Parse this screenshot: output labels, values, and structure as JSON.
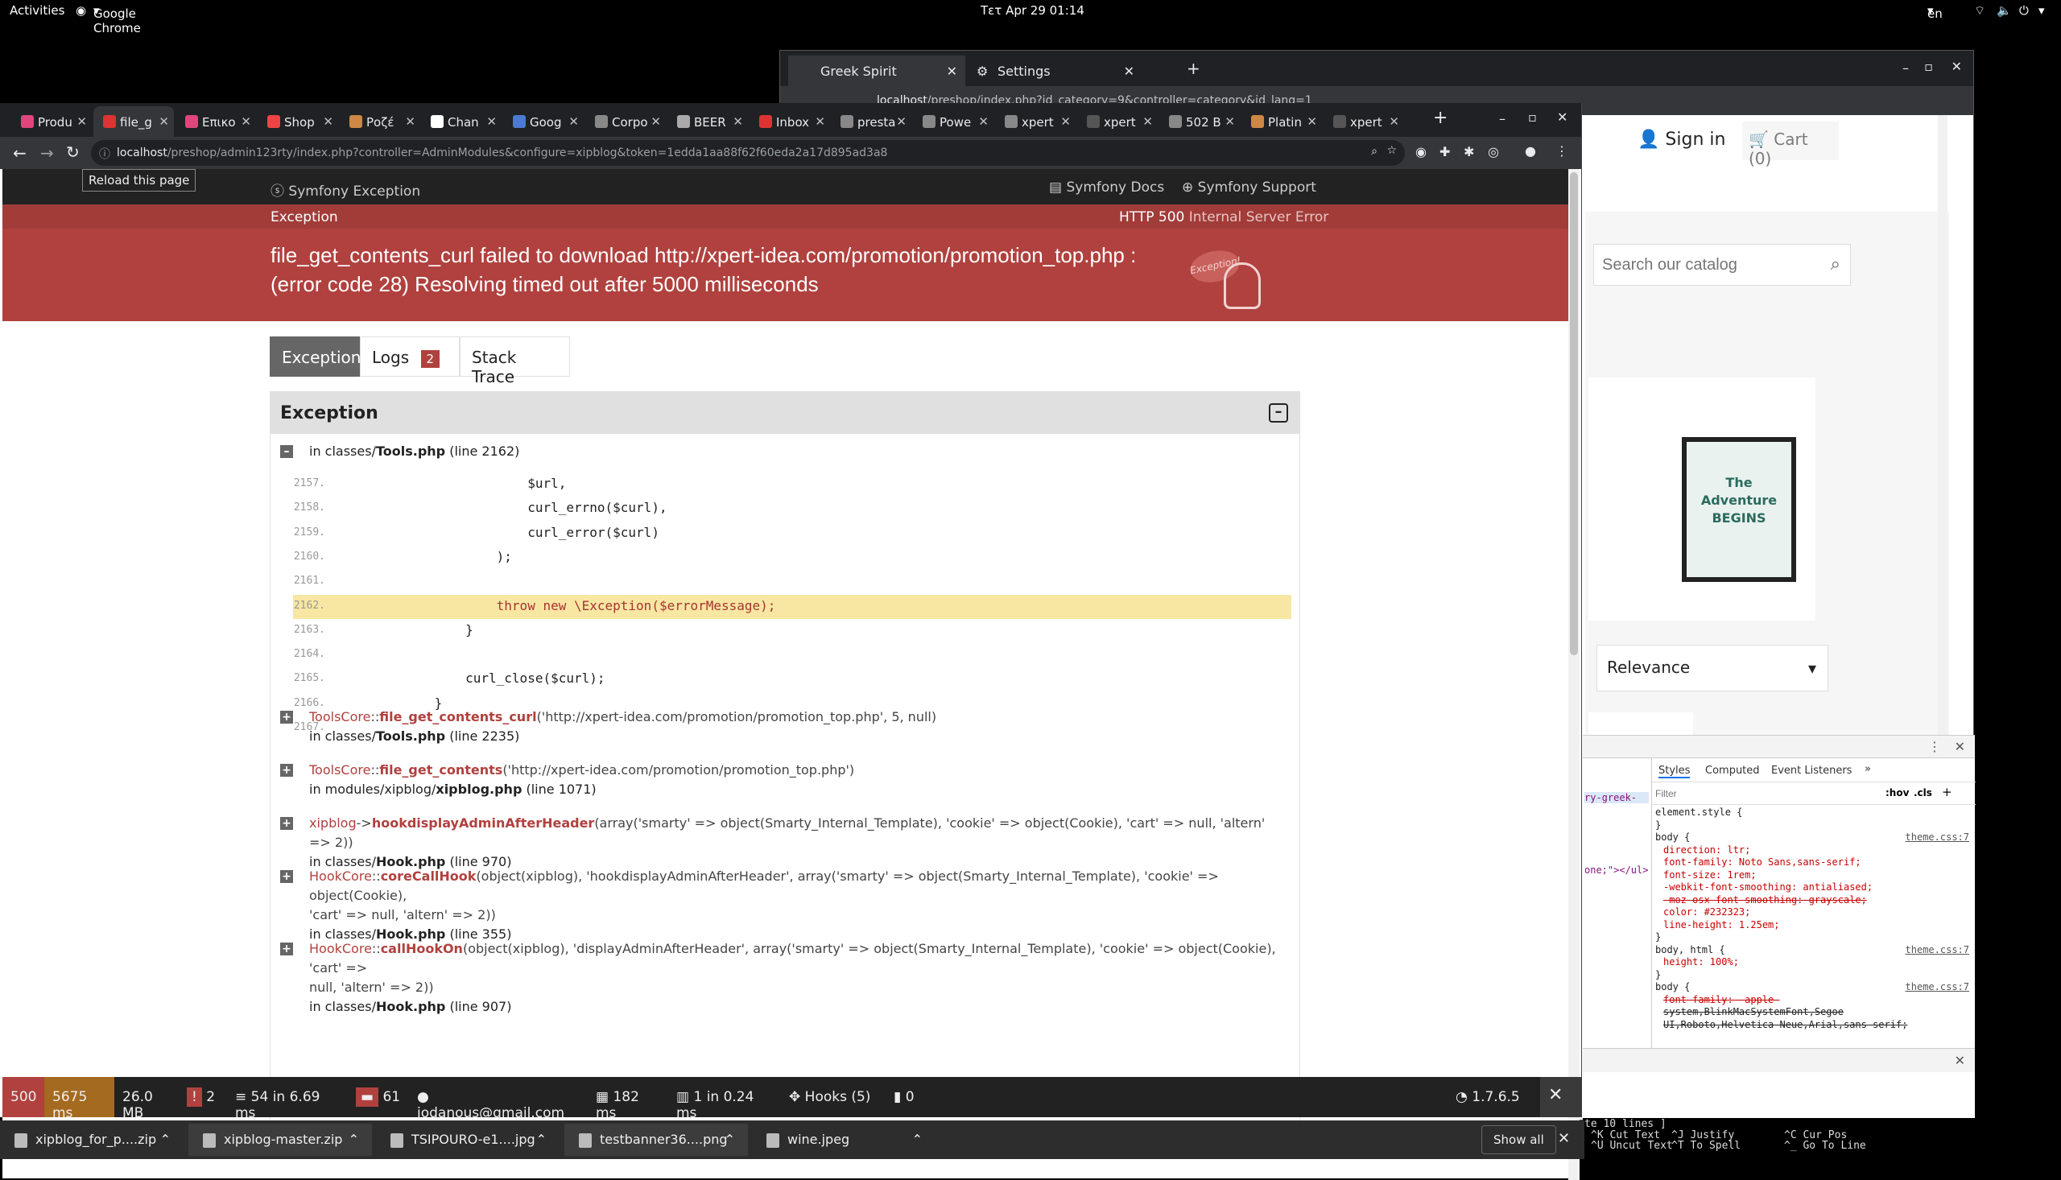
{
  "topbar": {
    "activities": "Activities",
    "app": "Google Chrome",
    "clock": "Τετ Apr 29  01:14",
    "lang": "en"
  },
  "backwin": {
    "tabs": [
      {
        "label": "Greek Spirit"
      },
      {
        "label": "Settings"
      }
    ],
    "url_host": "localhost",
    "url_path": "/preshop/index.php?id_category=9&controller=category&id_lang=1",
    "signin": "Sign in",
    "cart": "Cart (0)",
    "search_placeholder": "Search our catalog",
    "product_text": "The Adventure BEGINS",
    "sort_value": "Relevance",
    "devtools": {
      "tabs": [
        "Styles",
        "Computed",
        "Event Listeners"
      ],
      "filter_placeholder": "Filter",
      "hov": ":hov",
      "cls": ".cls",
      "left_snippets": [
        "ry-greek-",
        "one;\"></ul>"
      ],
      "css_lines": [
        "element.style {",
        "}",
        "body {",
        "direction: ltr;",
        "font-family: Noto Sans,sans-serif;",
        "font-size: 1rem;",
        "-webkit-font-smoothing: antialiased;",
        "-moz-osx-font-smoothing: grayscale;",
        "color: #232323;",
        "line-height: 1.25em;",
        "}",
        "body, html {",
        "height: 100%;",
        "}",
        "body {",
        "font-family: -apple-",
        "system,BlinkMacSystemFont,Segoe",
        "UI,Roboto,Helvetica Neue,Arial,sans-serif;"
      ],
      "source": "theme.css:7"
    },
    "nano_text": [
      "te 10 lines ]",
      "^K Cut Text",
      "^U Uncut Text",
      "^J Justify",
      "^T To Spell",
      "^C Cur Pos",
      "^_ Go To Line"
    ]
  },
  "mainwin": {
    "tabs": [
      {
        "label": "Produ",
        "color": "#e0457b"
      },
      {
        "label": "file_g",
        "color": "#d33"
      },
      {
        "label": "Επικο",
        "color": "#e0457b"
      },
      {
        "label": "Shop",
        "color": "#e44"
      },
      {
        "label": "Ροζέ",
        "color": "#c84"
      },
      {
        "label": "Chan",
        "color": "#fff"
      },
      {
        "label": "Goog",
        "color": "#4a7bd0"
      },
      {
        "label": "Corpo",
        "color": "#888"
      },
      {
        "label": "BEER",
        "color": "#aaa"
      },
      {
        "label": "Inbox",
        "color": "#d33"
      },
      {
        "label": "presta",
        "color": "#888"
      },
      {
        "label": "Powe",
        "color": "#888"
      },
      {
        "label": "xpert",
        "color": "#888"
      },
      {
        "label": "xpert",
        "color": "#555"
      },
      {
        "label": "502 B",
        "color": "#888"
      },
      {
        "label": "Platin",
        "color": "#c84"
      },
      {
        "label": "xpert",
        "color": "#555"
      }
    ],
    "tooltip": "Reload this page",
    "url_host": "localhost",
    "url_path": "/preshop/admin123rty/index.php?controller=AdminModules&configure=xipblog&token=1edda1aa88f62f60eda2a17d895ad3a8"
  },
  "symfony": {
    "brand": "Symfony Exception",
    "docs": "Symfony Docs",
    "support": "Symfony Support",
    "exc_label": "Exception",
    "http_code": "HTTP 500",
    "http_text": "Internal Server Error",
    "message_line1": "file_get_contents_curl failed to download http://xpert-idea.com/promotion/promotion_top.php :",
    "message_line2": "(error code 28) Resolving timed out after 5000 milliseconds",
    "ghost_label": "Exception!",
    "tabs": {
      "exception": "Exception",
      "logs": "Logs",
      "logs_count": "2",
      "trace": "Stack Trace"
    },
    "panel_title": "Exception",
    "first_in": "in classes/",
    "first_file": "Tools.php",
    "first_line": "(line 2162)",
    "code": [
      {
        "n": "2157.",
        "t": "                        $url,"
      },
      {
        "n": "2158.",
        "t": "                        curl_errno($curl),"
      },
      {
        "n": "2159.",
        "t": "                        curl_error($curl)"
      },
      {
        "n": "2160.",
        "t": "                    );"
      },
      {
        "n": "2161.",
        "t": ""
      },
      {
        "n": "2162.",
        "t": "                    throw new \\Exception($errorMessage);"
      },
      {
        "n": "2163.",
        "t": "                }"
      },
      {
        "n": "2164.",
        "t": ""
      },
      {
        "n": "2165.",
        "t": "                curl_close($curl);"
      },
      {
        "n": "2166.",
        "t": "            }"
      },
      {
        "n": "2167.",
        "t": ""
      }
    ],
    "trace": [
      {
        "cls": "ToolsCore",
        "sep": "::",
        "fn": "file_get_contents_curl",
        "args": "('http://xpert-idea.com/promotion/promotion_top.php', 5, null)",
        "args2": "",
        "in": "in classes/",
        "file": "Tools.php",
        "line": "(line 2235)"
      },
      {
        "cls": "ToolsCore",
        "sep": "::",
        "fn": "file_get_contents",
        "args": "('http://xpert-idea.com/promotion/promotion_top.php')",
        "args2": "",
        "in": "in modules/xipblog/",
        "file": "xipblog.php",
        "line": "(line 1071)"
      },
      {
        "cls": "xipblog",
        "sep": "->",
        "fn": "hookdisplayAdminAfterHeader",
        "args": "(array('smarty' => object(Smarty_Internal_Template), 'cookie' => object(Cookie), 'cart' => null, 'altern' => 2))",
        "args2": "",
        "in": "in classes/",
        "file": "Hook.php",
        "line": "(line 970)"
      },
      {
        "cls": "HookCore",
        "sep": "::",
        "fn": "coreCallHook",
        "args": "(object(xipblog), 'hookdisplayAdminAfterHeader', array('smarty' => object(Smarty_Internal_Template), 'cookie' => object(Cookie),",
        "args2": "'cart' => null, 'altern' => 2))",
        "in": "in classes/",
        "file": "Hook.php",
        "line": "(line 355)"
      },
      {
        "cls": "HookCore",
        "sep": "::",
        "fn": "callHookOn",
        "args": "(object(xipblog), 'displayAdminAfterHeader', array('smarty' => object(Smarty_Internal_Template), 'cookie' => object(Cookie), 'cart' =>",
        "args2": "null, 'altern' => 2))",
        "in": "in classes/",
        "file": "Hook.php",
        "line": "(line 907)"
      }
    ]
  },
  "debugbar": {
    "status": "500",
    "time": "5675 ms",
    "memory": "26.0 MB",
    "errors": "2",
    "queries": "54 in 6.69 ms",
    "logs": "61",
    "user": "jodanous@gmail.com",
    "config": "182 ms",
    "cache": "1 in 0.24 ms",
    "hooks": "Hooks (5)",
    "modules": "0",
    "version": "1.7.6.5"
  },
  "taskbar": {
    "items": [
      {
        "label": "xipblog_for_p....zip"
      },
      {
        "label": "xipblog-master.zip"
      },
      {
        "label": "TSIPOURO-e1....jpg"
      },
      {
        "label": "testbanner36....png"
      },
      {
        "label": "wine.jpeg"
      }
    ],
    "show_all": "Show all"
  }
}
